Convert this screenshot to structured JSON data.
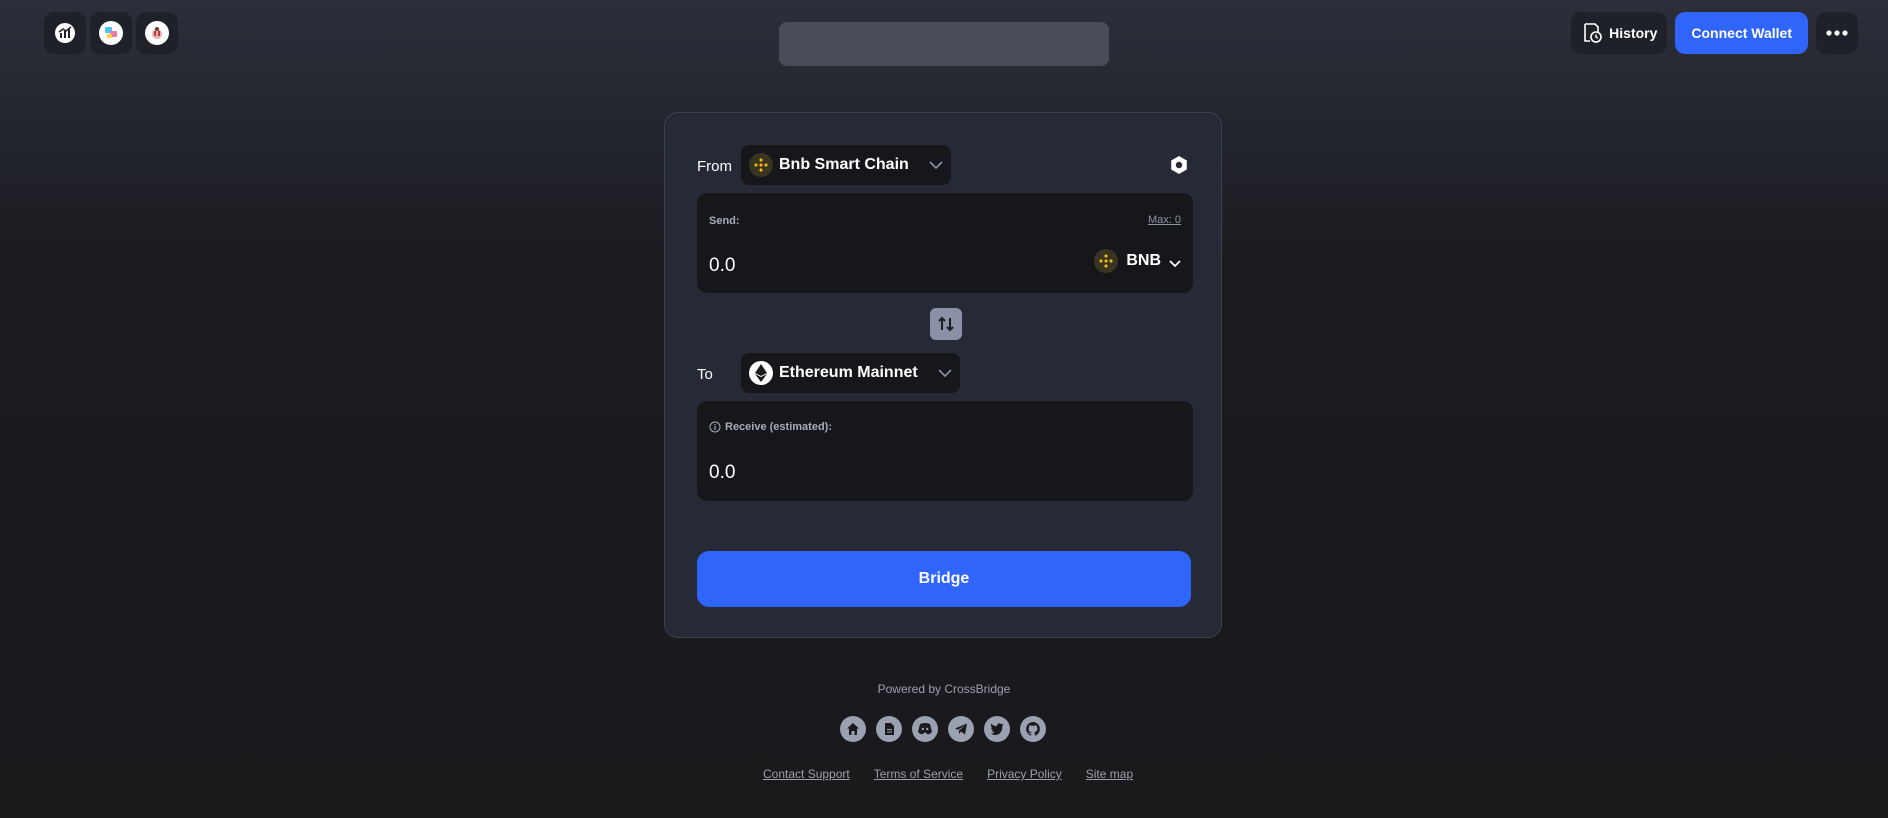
{
  "header": {
    "apps": [
      {
        "icon": "chart-app-icon"
      },
      {
        "icon": "multicolor-app-icon"
      },
      {
        "icon": "mascot-app-icon"
      }
    ],
    "history_label": "History",
    "connect_label": "Connect Wallet",
    "more_icon": "more-dots-icon"
  },
  "bridge": {
    "from_label": "From",
    "from_chain": "Bnb Smart Chain",
    "send_label": "Send:",
    "max_label": "Max: 0",
    "send_amount": "0.0",
    "token": "BNB",
    "to_label": "To",
    "to_chain": "Ethereum Mainnet",
    "receive_label": "Receive (estimated):",
    "receive_amount": "0.0",
    "bridge_button": "Bridge"
  },
  "footer": {
    "powered": "Powered by CrossBridge",
    "socials": [
      "home-icon",
      "docs-icon",
      "discord-icon",
      "telegram-icon",
      "twitter-icon",
      "github-icon"
    ],
    "links": [
      "Contact Support",
      "Terms of Service",
      "Privacy Policy",
      "Site map"
    ]
  },
  "colors": {
    "accent": "#3065fb",
    "card_bg": "#262a36",
    "field_bg": "#16171b",
    "bnb_yellow": "#f0b90b"
  }
}
